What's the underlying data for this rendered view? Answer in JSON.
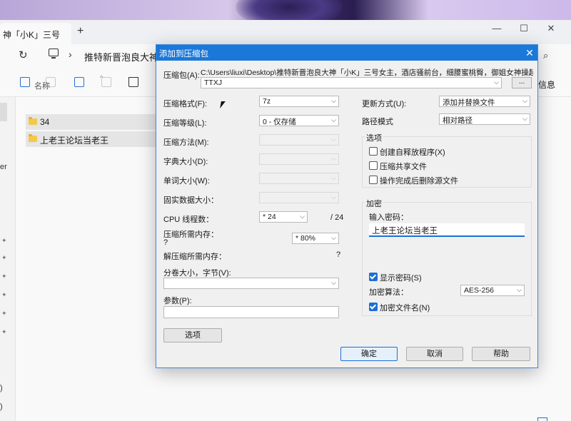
{
  "explorer": {
    "tab_title": "神「小K」三号",
    "tab_add": "+",
    "window_controls": {
      "minimize": "—",
      "maximize": "☐",
      "close": "✕"
    },
    "address_chevron": "›",
    "address_path": "推特新晋泡良大神「",
    "search_icon_glyph": "⌕",
    "info_label": "信息",
    "column_name": "名称",
    "sort_arrow": "^",
    "files": [
      {
        "name": "34"
      },
      {
        "name": "上老王论坛当老王"
      }
    ],
    "nav_fragments": [
      "er",
      ")",
      ")"
    ],
    "pin_glyph": "✦"
  },
  "dialog": {
    "title": "添加到压缩包",
    "close_glyph": "✕",
    "archive_label": "压缩包(A):",
    "archive_path": "C:\\Users\\liuxi\\Desktop\\推特新晋泡良大神「小K」三号女主，酒店骚前台，细腰蜜桃臀，御姐女神操起来就是得",
    "archive_name": "TTXJ",
    "browse_label": "...",
    "format_label": "压缩格式(F):",
    "format_value": "7z",
    "level_label": "压缩等级(L):",
    "level_value": "0 - 仅存储",
    "method_label": "压缩方法(M):",
    "dict_label": "字典大小(D):",
    "word_label": "单词大小(W):",
    "solid_label": "固实数据大小：",
    "cpu_label": "CPU 线程数：",
    "cpu_value": "* 24",
    "cpu_total": "/ 24",
    "mem_comp_label": "压缩所需内存：",
    "mem_comp_value": "?",
    "mem_comp_percent": "* 80%",
    "mem_decomp_label": "解压缩所需内存：",
    "mem_decomp_value": "?",
    "volume_label": "分卷大小，字节(V):",
    "params_label": "参数(P):",
    "options_button": "选项",
    "update_label": "更新方式(U):",
    "update_value": "添加并替换文件",
    "pathmode_label": "路径模式",
    "pathmode_value": "相对路径",
    "options_group": "选项",
    "opt_sfx": "创建自释放程序(X)",
    "opt_shared": "压缩共享文件",
    "opt_delete": "操作完成后删除源文件",
    "encrypt_group": "加密",
    "password_label": "输入密码：",
    "password_value": "上老王论坛当老王",
    "show_password": "显示密码(S)",
    "enc_method_label": "加密算法：",
    "enc_method_value": "AES-256",
    "encrypt_names": "加密文件名(N)",
    "ok_button": "确定",
    "cancel_button": "取消",
    "help_button": "帮助",
    "dropdown_arrow": "⌵"
  },
  "colors": {
    "accent": "#1b78d8",
    "folder": "#f2c94c"
  }
}
